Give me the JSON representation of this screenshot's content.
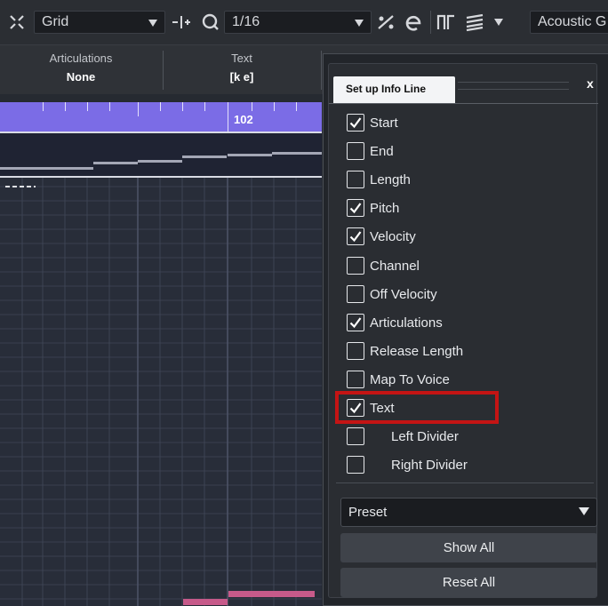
{
  "toolbar": {
    "snap_label": "Grid",
    "quantize_value": "1/16",
    "instrument": "Acoustic G"
  },
  "info_line": {
    "articulations_header": "Articulations",
    "articulations_value": "None",
    "text_header": "Text",
    "text_value": "[k e]"
  },
  "ruler": {
    "bar_number": "102"
  },
  "dialog": {
    "tab_title": "Set up Info Line",
    "close_label": "x",
    "items": [
      {
        "label": "Start",
        "checked": true
      },
      {
        "label": "End",
        "checked": false
      },
      {
        "label": "Length",
        "checked": false
      },
      {
        "label": "Pitch",
        "checked": true
      },
      {
        "label": "Velocity",
        "checked": true
      },
      {
        "label": "Channel",
        "checked": false
      },
      {
        "label": "Off Velocity",
        "checked": false
      },
      {
        "label": "Articulations",
        "checked": true
      },
      {
        "label": "Release Length",
        "checked": false
      },
      {
        "label": "Map To Voice",
        "checked": false
      },
      {
        "label": "Text",
        "checked": true
      },
      {
        "label": "Left Divider",
        "checked": false
      },
      {
        "label": "Right Divider",
        "checked": false
      }
    ],
    "preset_label": "Preset",
    "show_all_label": "Show All",
    "reset_all_label": "Reset All"
  },
  "colors": {
    "ruler": "#7b6ce6",
    "highlight": "#c41414",
    "note": "#c75a8a"
  }
}
